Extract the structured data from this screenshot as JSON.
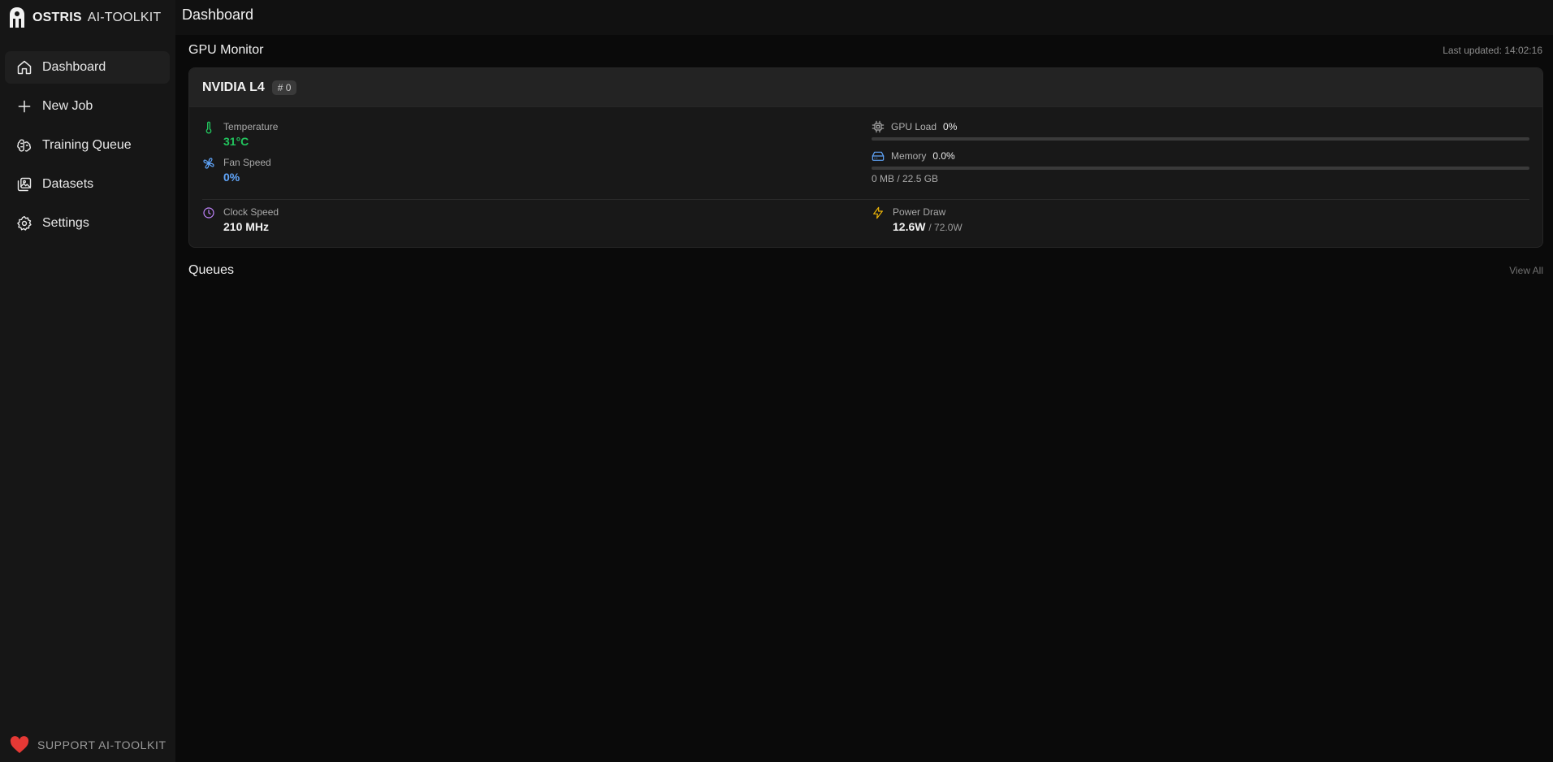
{
  "brand": {
    "name": "OSTRIS",
    "sub": "AI-TOOLKIT"
  },
  "header": {
    "title": "Dashboard"
  },
  "sidebar": {
    "items": [
      {
        "label": "Dashboard",
        "icon": "home-icon",
        "active": true
      },
      {
        "label": "New Job",
        "icon": "plus-icon",
        "active": false
      },
      {
        "label": "Training Queue",
        "icon": "brain-icon",
        "active": false
      },
      {
        "label": "Datasets",
        "icon": "images-icon",
        "active": false
      },
      {
        "label": "Settings",
        "icon": "gear-icon",
        "active": false
      }
    ],
    "support": "SUPPORT AI-TOOLKIT"
  },
  "gpu_monitor": {
    "title": "GPU Monitor",
    "last_updated_label": "Last updated:",
    "last_updated_time": "14:02:16",
    "gpu": {
      "name": "NVIDIA L4",
      "index": "# 0",
      "temperature": {
        "label": "Temperature",
        "value": "31°C"
      },
      "fan_speed": {
        "label": "Fan Speed",
        "value": "0%"
      },
      "clock_speed": {
        "label": "Clock Speed",
        "value": "210 MHz"
      },
      "gpu_load": {
        "label": "GPU Load",
        "value": "0%",
        "fraction": 0.0
      },
      "memory": {
        "label": "Memory",
        "value": "0.0%",
        "fraction": 0.0,
        "detail": "0 MB / 22.5 GB"
      },
      "power_draw": {
        "label": "Power Draw",
        "value": "12.6W",
        "limit": "/ 72.0W"
      }
    }
  },
  "queues": {
    "title": "Queues",
    "view_all": "View All"
  },
  "colors": {
    "temp": "#22c55e",
    "fan": "#60a5fa",
    "clock": "#c084fc",
    "power": "#eab308",
    "heart": "#e53935"
  }
}
